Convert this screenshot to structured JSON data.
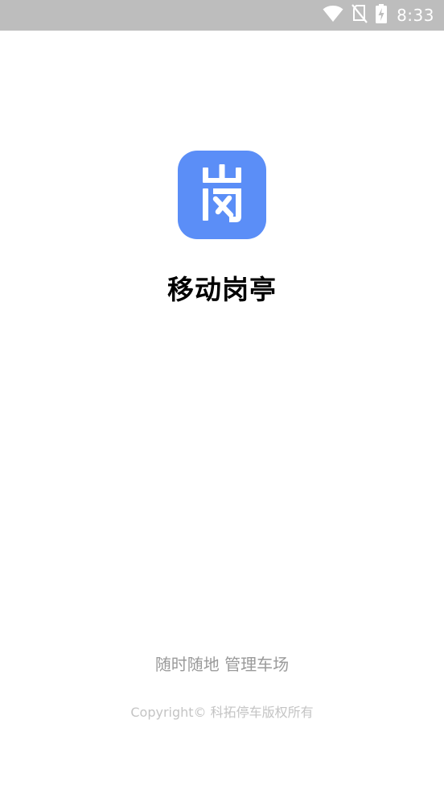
{
  "status_bar": {
    "time": "8:33",
    "icons": [
      "wifi-icon",
      "no-sim-icon",
      "battery-charging-icon"
    ],
    "background": "#bdbdbd"
  },
  "splash": {
    "logo_icon": "gang-character-logo",
    "logo_color": "#5b8ef7",
    "app_name": "移动岗亭",
    "slogan": "随时随地 管理车场",
    "copyright": "Copyright© 科拓停车版权所有"
  }
}
